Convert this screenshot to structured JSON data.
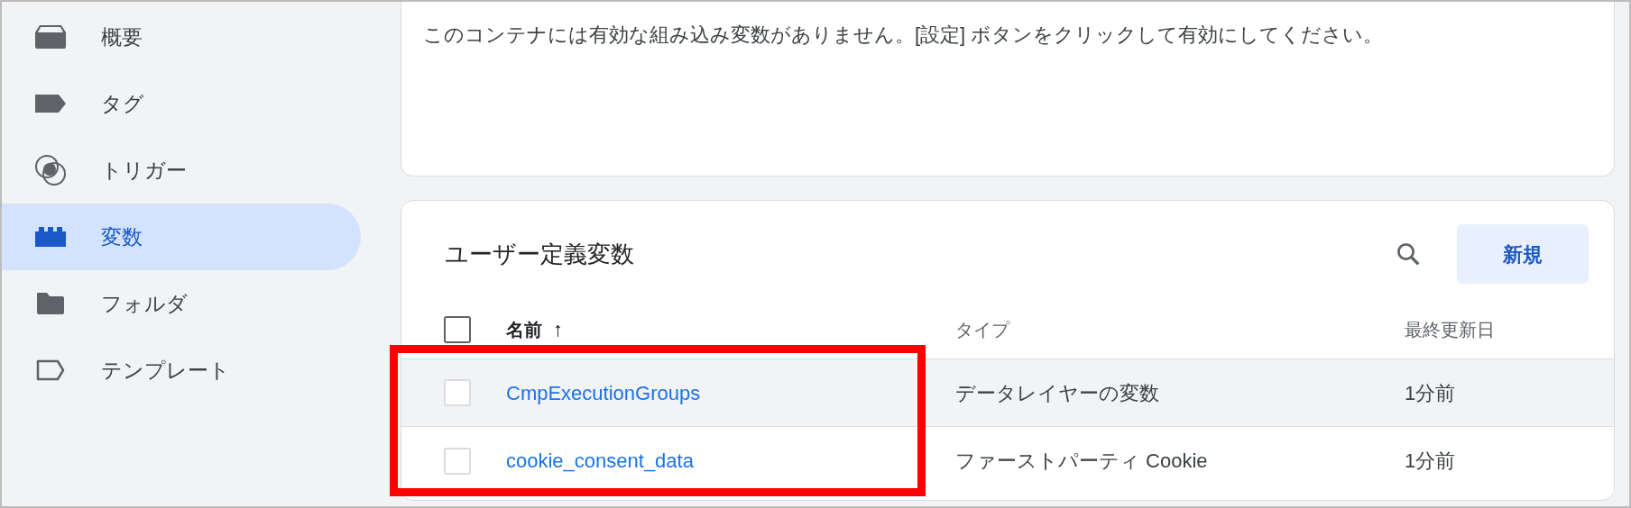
{
  "sidebar": {
    "items": [
      {
        "label": "概要",
        "selected": false
      },
      {
        "label": "タグ",
        "selected": false
      },
      {
        "label": "トリガー",
        "selected": false
      },
      {
        "label": "変数",
        "selected": true
      },
      {
        "label": "フォルダ",
        "selected": false
      },
      {
        "label": "テンプレート",
        "selected": false
      }
    ]
  },
  "builtin_card": {
    "message": "このコンテナには有効な組み込み変数がありません。[設定] ボタンをクリックして有効にしてください。"
  },
  "user_vars": {
    "title": "ユーザー定義変数",
    "new_button": "新規",
    "columns": [
      {
        "label": "名前",
        "sort": "↑"
      },
      {
        "label": "タイプ"
      },
      {
        "label": "最終更新日"
      }
    ],
    "select_all": {
      "checked": false
    },
    "rows": [
      {
        "name": "CmpExecutionGroups",
        "type": "データレイヤーの変数",
        "updated": "1分前",
        "checked": false,
        "highlighted": true
      },
      {
        "name": "cookie_consent_data",
        "type": "ファーストパーティ Cookie",
        "updated": "1分前",
        "checked": false,
        "highlighted": false
      }
    ]
  },
  "annotation": {
    "kind": "highlight-frame"
  }
}
